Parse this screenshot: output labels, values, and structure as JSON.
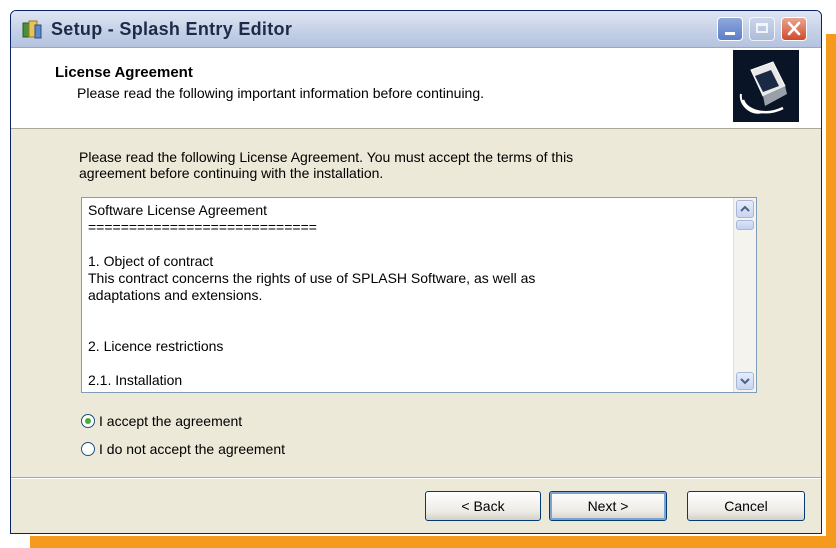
{
  "window": {
    "title": "Setup - Splash Entry Editor"
  },
  "header": {
    "title": "License Agreement",
    "subtitle": "Please read the following important information before continuing."
  },
  "main": {
    "intro_line1": "Please read the following License Agreement. You must accept the terms of this",
    "intro_line2": "agreement before continuing with the installation.",
    "license_lines": [
      "Software License Agreement",
      "============================",
      "",
      "1. Object of contract",
      "This contract concerns the rights of use of SPLASH Software, as well as",
      "adaptations and extensions.",
      "",
      "",
      "2. Licence restrictions",
      "",
      "2.1. Installation"
    ],
    "accept_label": "I accept the agreement",
    "decline_label": "I do not accept the agreement",
    "selected_option": "accept"
  },
  "buttons": {
    "back": "< Back",
    "next": "Next >",
    "cancel": "Cancel"
  },
  "colors": {
    "frame_accent": "#f59a1c",
    "radio_selected": "#43b12e"
  }
}
